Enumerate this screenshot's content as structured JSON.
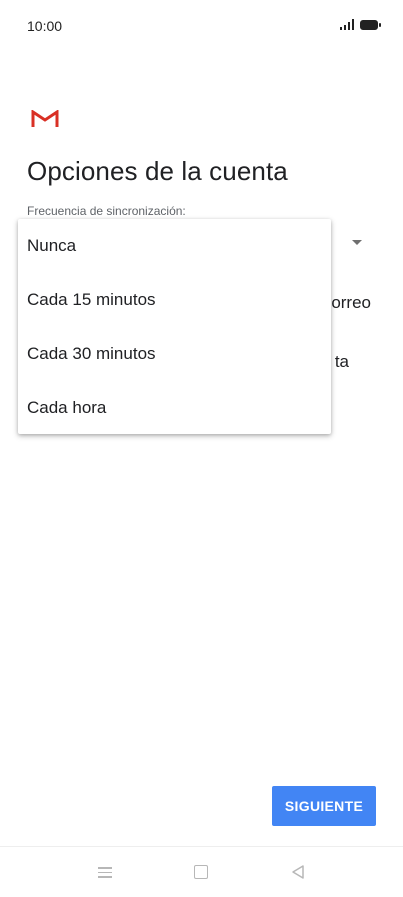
{
  "status_bar": {
    "time": "10:00"
  },
  "header": {
    "title": "Opciones de la cuenta",
    "field_label": "Frecuencia de sincronización:"
  },
  "background": {
    "partial_text_1": "orreo",
    "partial_text_2": "ta"
  },
  "dropdown": {
    "options": [
      "Nunca",
      "Cada 15 minutos",
      "Cada 30 minutos",
      "Cada hora"
    ]
  },
  "footer": {
    "next_label": "SIGUIENTE"
  },
  "colors": {
    "accent": "#4285f4",
    "gmail_red": "#d93025"
  },
  "icons": {
    "app": "gmail-icon",
    "nav": [
      "menu-icon",
      "home-icon",
      "back-icon"
    ]
  }
}
